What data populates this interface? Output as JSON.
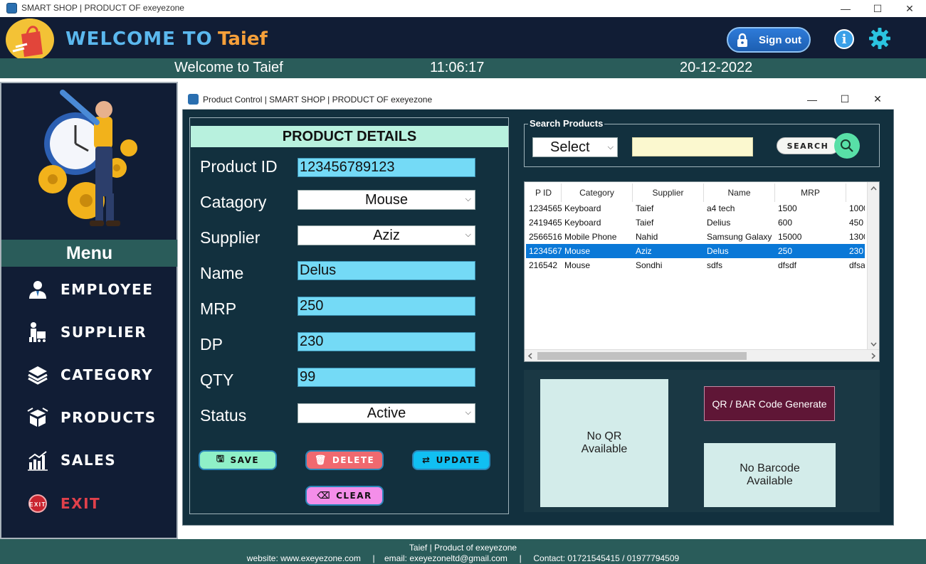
{
  "window": {
    "title": "SMART SHOP | PRODUCT OF exeyezone",
    "controls": {
      "minimize": "—",
      "maximize": "☐",
      "close": "✕"
    }
  },
  "header": {
    "welcome": "WELCOME TO",
    "user": "Taief",
    "signout": "Sign out",
    "info_icon": "info-icon",
    "settings_icon": "gear-icon"
  },
  "status": {
    "welcome_text": "Welcome to Taief",
    "time": "11:06:17",
    "date": "20-12-2022"
  },
  "sidebar": {
    "menu_title": "Menu",
    "items": [
      {
        "label": "EMPLOYEE",
        "icon": "employee-icon"
      },
      {
        "label": "SUPPLIER",
        "icon": "supplier-icon"
      },
      {
        "label": "CATEGORY",
        "icon": "layers-icon"
      },
      {
        "label": "PRODUCTS",
        "icon": "box-icon"
      },
      {
        "label": "SALES",
        "icon": "chart-icon"
      },
      {
        "label": "EXIT",
        "icon": "exit-icon"
      }
    ],
    "colors": {
      "exit": "#e0404b",
      "normal": "#ffffff"
    }
  },
  "inner_window": {
    "title": "Product Control  |  SMART SHOP | PRODUCT OF exeyezone"
  },
  "product_details": {
    "header": "PRODUCT DETAILS",
    "fields": {
      "product_id": {
        "label": "Product ID",
        "value": "123456789123"
      },
      "category": {
        "label": "Catagory",
        "value": "Mouse"
      },
      "supplier": {
        "label": "Supplier",
        "value": "Aziz"
      },
      "name": {
        "label": "Name",
        "value": "Delus"
      },
      "mrp": {
        "label": "MRP",
        "value": "250"
      },
      "dp": {
        "label": "DP",
        "value": "230"
      },
      "qty": {
        "label": "QTY",
        "value": "99"
      },
      "status": {
        "label": "Status",
        "value": "Active"
      }
    },
    "buttons": {
      "save": "SAVE",
      "delete": "DELETE",
      "update": "UPDATE",
      "clear": "CLEAR"
    }
  },
  "search": {
    "group_label": "Search Products",
    "select_value": "Select",
    "input_value": "",
    "button_label": "SEARCH"
  },
  "table": {
    "columns": [
      "P ID",
      "Category",
      "Supplier",
      "Name",
      "MRP",
      ""
    ],
    "rows": [
      [
        "1234565",
        "Keyboard",
        "Taief",
        "a4 tech",
        "1500",
        "1000"
      ],
      [
        "2419465",
        "Keyboard",
        "Taief",
        "Delius",
        "600",
        "450"
      ],
      [
        "2566516",
        "Mobile Phone",
        "Nahid",
        "Samsung Galaxy",
        "15000",
        "1300"
      ],
      [
        "1234567",
        "Mouse",
        "Aziz",
        "Delus",
        "250",
        "230"
      ],
      [
        "216542",
        "Mouse",
        "Sondhi",
        "sdfs",
        "dfsdf",
        "dfsa"
      ]
    ],
    "selected_row": 3
  },
  "codes": {
    "qr_placeholder": "No QR\nAvailable",
    "generate_button": "QR / BAR Code Generate",
    "barcode_placeholder": "No Barcode\nAvailable"
  },
  "footer": {
    "line1": "Taief | Product of exeyezone",
    "line2": "website: www.exeyezone.com     |    email: exeyezoneltd@gmail.com     |     Contact: 01721545415 / 01977794509"
  }
}
